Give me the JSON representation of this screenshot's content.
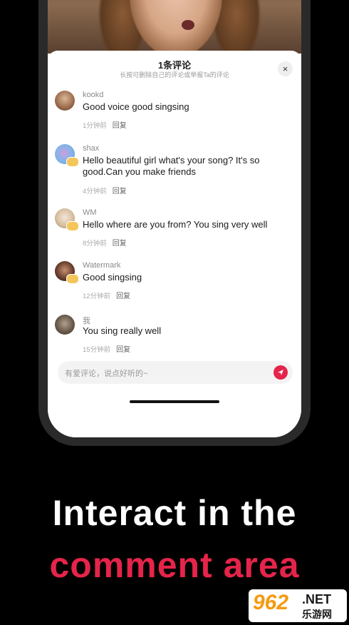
{
  "sheet": {
    "title": "1条评论",
    "subtitle": "长按可删除自己的评论或举报Ta的评论",
    "close_label": "×"
  },
  "comments": [
    {
      "name": "kookd",
      "text": "Good voice good singsing",
      "time": "1分钟前",
      "reply": "回复"
    },
    {
      "name": "shax",
      "text": "Hello beautiful girl what's your song? It's so good.Can you make friends",
      "time": "4分钟前",
      "reply": "回复"
    },
    {
      "name": "WM",
      "text": "Hello where are you from? You sing very well",
      "time": "8分钟前",
      "reply": "回复"
    },
    {
      "name": "Watermark",
      "text": "Good singsing",
      "time": "12分钟前",
      "reply": "回复"
    },
    {
      "name": "我",
      "text": "You sing really well",
      "time": "15分钟前",
      "reply": "回复"
    }
  ],
  "input": {
    "placeholder": "有爱评论，说点好听的~"
  },
  "headline": {
    "line1": "Interact in the",
    "line2": "comment area"
  },
  "watermark": {
    "num": "962",
    "net": ".NET",
    "cn": "乐游网"
  },
  "colors": {
    "accent": "#e5244a",
    "badge": "#f4c65a"
  }
}
